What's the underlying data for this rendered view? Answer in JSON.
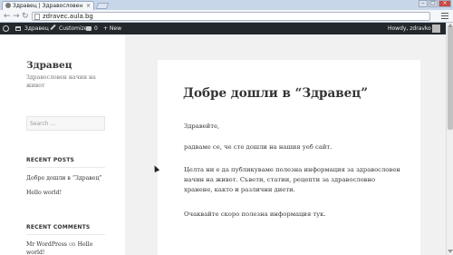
{
  "browser": {
    "tab_title": "Здравец | Здравословен",
    "tab_close": "×",
    "url": "zdravec.aula.bg",
    "window_min": "–",
    "window_max": "□",
    "window_close": "×"
  },
  "adminbar": {
    "site_name": "Здравец",
    "customize": "Customize",
    "comments_count": "0",
    "new_label": "+ New",
    "greeting": "Howdy, zdravko"
  },
  "sidebar": {
    "site_title": "Здравец",
    "site_description": "Здравословен начин на живот",
    "search_placeholder": "Search ...",
    "recent_posts_title": "RECENT POSTS",
    "recent_posts": [
      "Добре дошли в “Здравец”",
      "Hello world!"
    ],
    "recent_comments_title": "RECENT COMMENTS",
    "comment_author": "Mr WordPress",
    "comment_on": "on",
    "comment_post": "Hello world!"
  },
  "article": {
    "title": "Добре дошли в “Здравец”",
    "paragraphs": [
      "Здравейте,",
      "радваме се, че сте дошли на нашия уеб сайт.",
      "Целта ни е да публикуваме полезна информация за здравословен начин на живот. Съвети, статии, рецепти за здравословно хранене, както и различни диети.",
      "Очаквайте скоро полезна информация тук."
    ]
  },
  "colors": {
    "adminbar_bg": "#23282d",
    "page_bg": "#f1f1f1",
    "text": "#333333"
  }
}
